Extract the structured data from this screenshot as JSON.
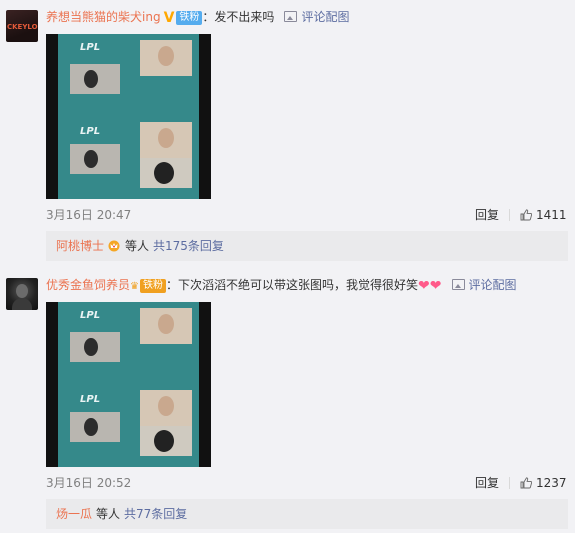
{
  "comments": [
    {
      "avatar_text": "CKEYLO",
      "username": "养想当熊猫的柴犬ing",
      "badge": "铁粉",
      "text": "发不出来吗",
      "pic_link": "评论配图",
      "date": "3月16日 20:47",
      "reply_label": "回复",
      "likes": "1411",
      "thumb_lpl": "LPL",
      "sub": {
        "name": "阿桃博士",
        "rest": "等人",
        "link": "共175条回复"
      }
    },
    {
      "username": "优秀金鱼饲养员",
      "badge": "铁粉",
      "text": "下次滔滔不绝可以带这张图吗，我觉得很好笑",
      "pic_link": "评论配图",
      "date": "3月16日 20:52",
      "reply_label": "回复",
      "likes": "1237",
      "thumb_lpl": "LPL",
      "sub": {
        "name": "炀一瓜",
        "rest": "等人",
        "link": "共77条回复"
      }
    }
  ],
  "colors": {
    "username": "#eb7350",
    "link": "#5d6da1",
    "meta": "#808080",
    "subbox": "#eaeaec"
  },
  "icons": [
    "verified-v-icon",
    "picture-icon",
    "thumbs-up-icon",
    "heart-icon",
    "crown-icon"
  ]
}
